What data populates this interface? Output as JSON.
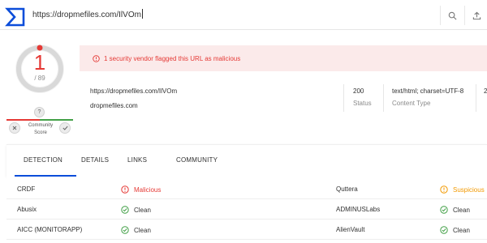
{
  "search": {
    "url_value": "https://dropmefiles.com/IlVOm"
  },
  "colors": {
    "malicious": "#e53935",
    "suspicious": "#f29900",
    "clean": "#43a047",
    "brand": "#0b4dda"
  },
  "score": {
    "detections": "1",
    "total": "/ 89",
    "detection_fraction": 0.011
  },
  "community": {
    "question_mark": "?",
    "label_line1": "Community",
    "label_line2": "Score"
  },
  "alert": {
    "text": "1 security vendor flagged this URL as malicious"
  },
  "info": {
    "url": "https://dropmefiles.com/IlVOm",
    "host": "dropmefiles.com",
    "status_value": "200",
    "status_label": "Status",
    "content_type_value": "text/html; charset=UTF-8",
    "content_type_label": "Content Type",
    "cut_off_value": "2"
  },
  "tabs": [
    {
      "label": "DETECTION",
      "active": true
    },
    {
      "label": "DETAILS",
      "active": false
    },
    {
      "label": "LINKS",
      "active": false
    },
    {
      "label": "COMMUNITY",
      "active": false
    }
  ],
  "detections": [
    {
      "vendor_left": "CRDF",
      "verdict_left": "Malicious",
      "status_left": "malicious",
      "vendor_right": "Quttera",
      "verdict_right": "Suspicious",
      "status_right": "suspicious"
    },
    {
      "vendor_left": "Abusix",
      "verdict_left": "Clean",
      "status_left": "clean",
      "vendor_right": "ADMINUSLabs",
      "verdict_right": "Clean",
      "status_right": "clean"
    },
    {
      "vendor_left": "AICC (MONITORAPP)",
      "verdict_left": "Clean",
      "status_left": "clean",
      "vendor_right": "AlienVault",
      "verdict_right": "Clean",
      "status_right": "clean"
    }
  ],
  "icons": {
    "logo": "virustotal-logo",
    "search": "search-icon",
    "upload": "upload-icon",
    "alert": "alert-circle-icon",
    "clean": "check-circle-icon"
  }
}
